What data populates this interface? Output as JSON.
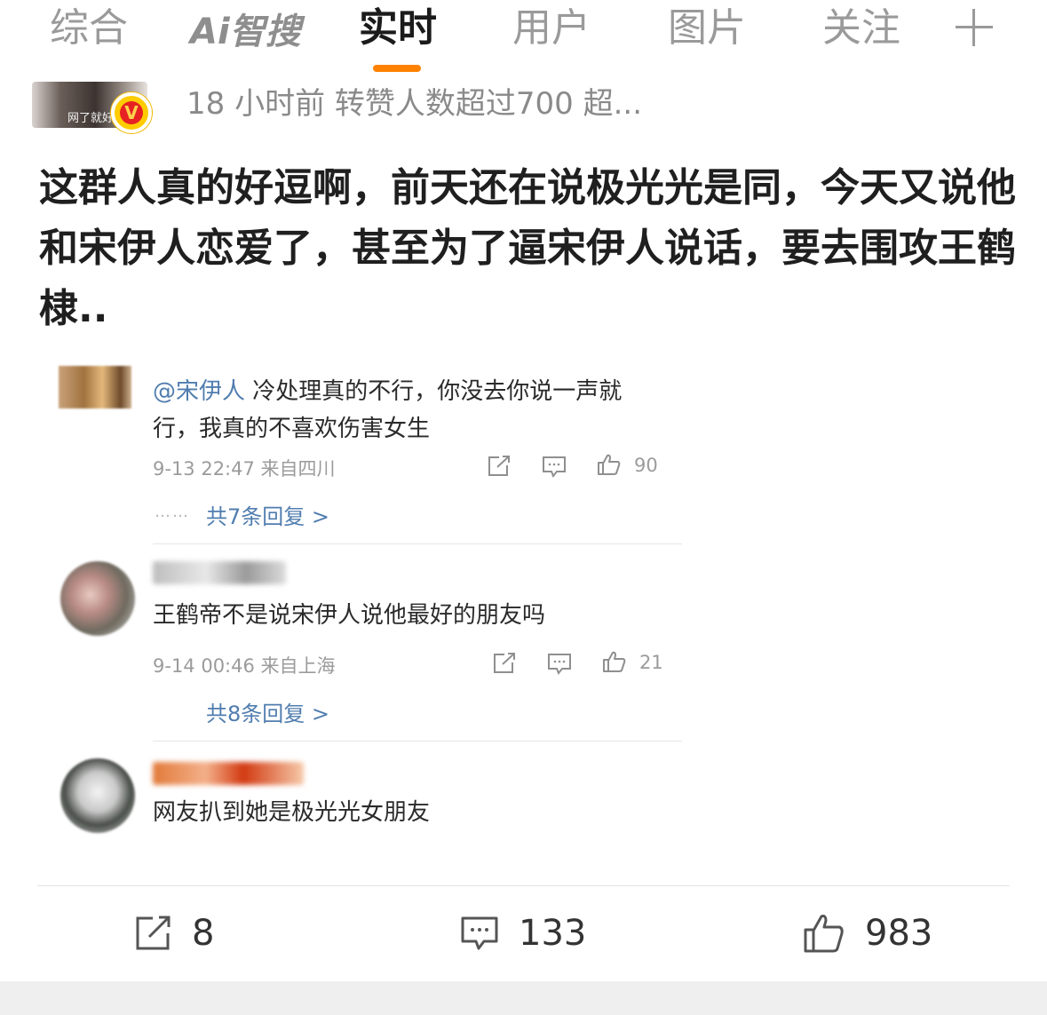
{
  "tabs": {
    "items": [
      "综合",
      "Ai智搜",
      "实时",
      "用户",
      "图片",
      "关注"
    ],
    "active": "实时"
  },
  "post": {
    "avatar_label": "网了就好",
    "verified_badge": "V",
    "meta": "18 小时前 转赞人数超过700  超...",
    "text": "这群人真的好逗啊，前天还在说极光光是同，今天又说他和宋伊人恋爱了，甚至为了逼宋伊人说话，要去围攻王鹤棣.."
  },
  "embedded_comments": [
    {
      "mention": "@宋伊人",
      "text": " 冷处理真的不行，你没去你说一声就行，我真的不喜欢伤害女生",
      "meta": "9-13 22:47  来自四川",
      "likes": "90",
      "dots": "……",
      "replies": "共7条回复 >"
    },
    {
      "text": "王鹤帝不是说宋伊人说他最好的朋友吗",
      "meta": "9-14 00:46  来自上海",
      "likes": "21",
      "replies": "共8条回复 >"
    },
    {
      "text": "网友扒到她是极光光女朋友"
    }
  ],
  "action_bar": {
    "reposts": "8",
    "comments": "133",
    "likes": "983"
  },
  "colors": {
    "accent": "#ff8200",
    "link": "#507daf",
    "muted": "#9b9b9b"
  }
}
